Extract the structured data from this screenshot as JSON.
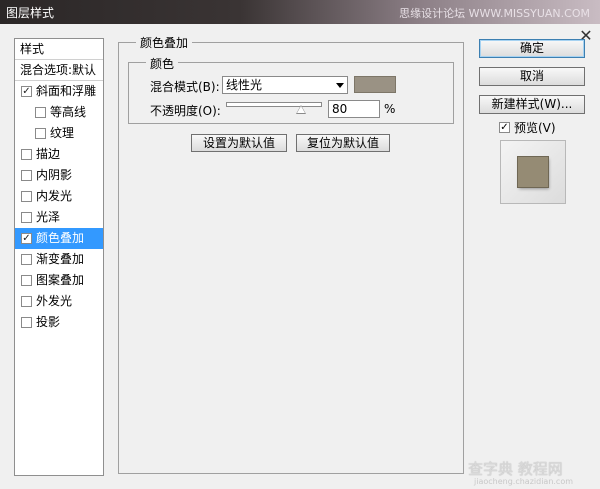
{
  "window": {
    "title": "图层样式",
    "watermark": "思缘设计论坛  WWW.MISSYUAN.COM",
    "close_glyph": "✕"
  },
  "sidebar": {
    "items": [
      {
        "label": "样式",
        "checkbox": false,
        "checked": false,
        "selected": false,
        "header": true
      },
      {
        "label": "混合选项:默认",
        "checkbox": false,
        "checked": false,
        "selected": false,
        "header": true
      },
      {
        "label": "斜面和浮雕",
        "checkbox": true,
        "checked": true,
        "selected": false
      },
      {
        "label": "等高线",
        "checkbox": true,
        "checked": false,
        "selected": false,
        "indent": true
      },
      {
        "label": "纹理",
        "checkbox": true,
        "checked": false,
        "selected": false,
        "indent": true
      },
      {
        "label": "描边",
        "checkbox": true,
        "checked": false,
        "selected": false
      },
      {
        "label": "内阴影",
        "checkbox": true,
        "checked": false,
        "selected": false
      },
      {
        "label": "内发光",
        "checkbox": true,
        "checked": false,
        "selected": false
      },
      {
        "label": "光泽",
        "checkbox": true,
        "checked": false,
        "selected": false
      },
      {
        "label": "颜色叠加",
        "checkbox": true,
        "checked": true,
        "selected": true
      },
      {
        "label": "渐变叠加",
        "checkbox": true,
        "checked": false,
        "selected": false
      },
      {
        "label": "图案叠加",
        "checkbox": true,
        "checked": false,
        "selected": false
      },
      {
        "label": "外发光",
        "checkbox": true,
        "checked": false,
        "selected": false
      },
      {
        "label": "投影",
        "checkbox": true,
        "checked": false,
        "selected": false
      }
    ]
  },
  "panel": {
    "title": "颜色叠加",
    "group_title": "颜色",
    "blend_mode_label": "混合模式(B):",
    "blend_mode_value": "线性光",
    "overlay_color": "#9a9284",
    "opacity_label": "不透明度(O):",
    "opacity_value": "80",
    "opacity_unit": "%",
    "opacity_fraction": 0.8,
    "set_default_label": "设置为默认值",
    "reset_default_label": "复位为默认值"
  },
  "actions": {
    "ok_label": "确定",
    "cancel_label": "取消",
    "new_style_label": "新建样式(W)...",
    "preview_label": "预览(V)",
    "preview_checked": true
  },
  "footer_watermark": {
    "main": "查字典 教程网",
    "sub": "jiaocheng.chazidian.com"
  },
  "colors": {
    "selection": "#3399ff",
    "preview_square": "#958b74"
  }
}
